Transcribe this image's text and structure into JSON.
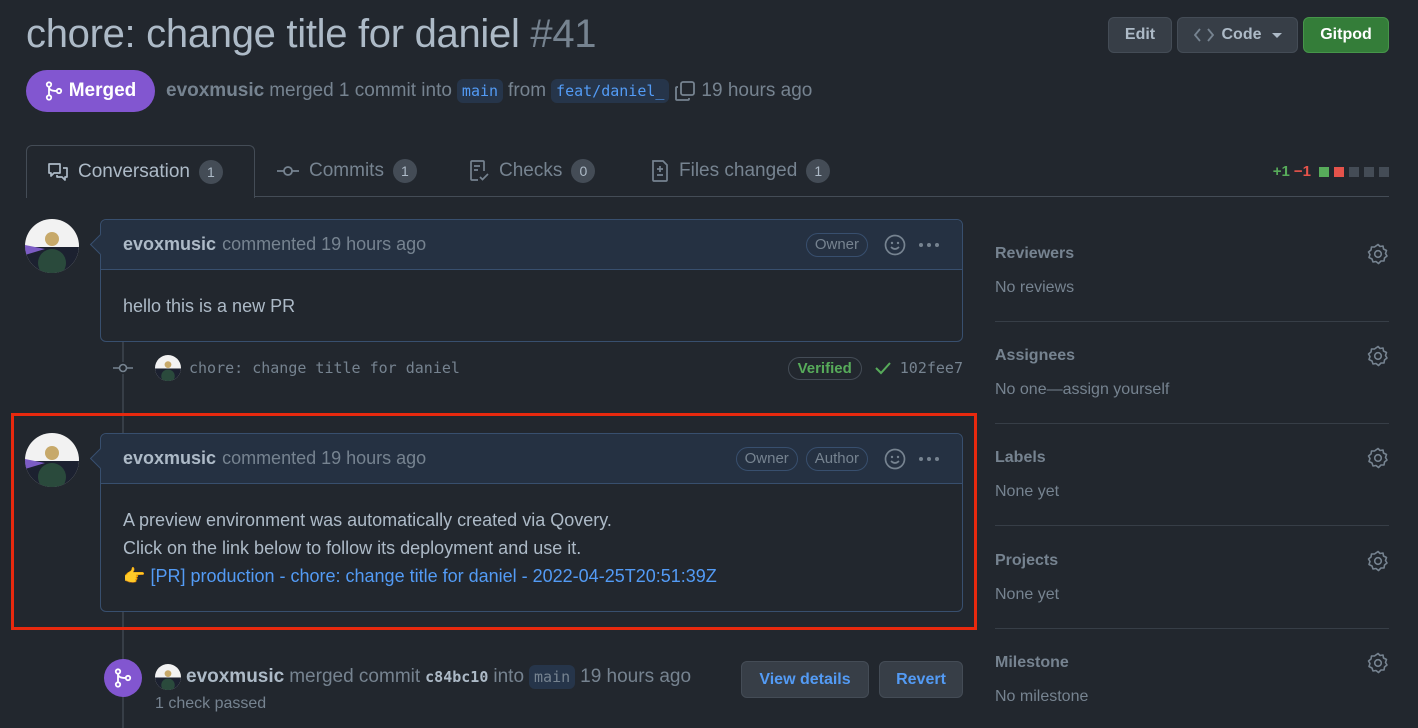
{
  "header": {
    "title": "chore: change title for daniel",
    "number": "#41",
    "buttons": {
      "edit": "Edit",
      "code": "Code",
      "gitpod": "Gitpod"
    },
    "state": "Merged",
    "meta": {
      "author": "evoxmusic",
      "text1": "merged 1 commit into",
      "base_branch": "main",
      "text2": "from",
      "head_branch": "feat/daniel_",
      "time": "19 hours ago"
    }
  },
  "tabs": [
    {
      "label": "Conversation",
      "count": "1",
      "icon": "comment-discussion-icon"
    },
    {
      "label": "Commits",
      "count": "1",
      "icon": "git-commit-icon"
    },
    {
      "label": "Checks",
      "count": "0",
      "icon": "checklist-icon"
    },
    {
      "label": "Files changed",
      "count": "1",
      "icon": "file-diff-icon"
    }
  ],
  "diffstat": {
    "additions": "+1",
    "deletions": "−1",
    "blocks": [
      "add",
      "del",
      "neutral",
      "neutral",
      "neutral"
    ]
  },
  "timeline": {
    "comment1": {
      "author": "evoxmusic",
      "action": "commented 19 hours ago",
      "roles": [
        "Owner"
      ],
      "body": "hello this is a new PR"
    },
    "commit": {
      "message": "chore: change title for daniel",
      "verified": "Verified",
      "sha": "102fee7"
    },
    "comment2": {
      "author": "evoxmusic",
      "action": "commented 19 hours ago",
      "roles": [
        "Owner",
        "Author"
      ],
      "line1": "A preview environment was automatically created via Qovery.",
      "line2": "Click on the link below to follow its deployment and use it.",
      "emoji": "👉",
      "link": "[PR] production - chore: change title for daniel - 2022-04-25T20:51:39Z"
    },
    "merge_event": {
      "author": "evoxmusic",
      "text1": "merged commit",
      "sha": "c84bc10",
      "text2": "into",
      "branch": "main",
      "time": "19 hours ago",
      "checks": "1 check passed",
      "view_details": "View details",
      "revert": "Revert"
    }
  },
  "sidebar": [
    {
      "title": "Reviewers",
      "value": "No reviews"
    },
    {
      "title": "Assignees",
      "value": "No one—assign yourself"
    },
    {
      "title": "Labels",
      "value": "None yet"
    },
    {
      "title": "Projects",
      "value": "None yet"
    },
    {
      "title": "Milestone",
      "value": "No milestone"
    }
  ],
  "colors": {
    "background": "#22272e",
    "merged": "#8256d0",
    "gitpod": "#347d39",
    "link": "#539bf5",
    "add": "#57ab5a",
    "del": "#e5534b",
    "highlight_box": "#e8290e"
  }
}
